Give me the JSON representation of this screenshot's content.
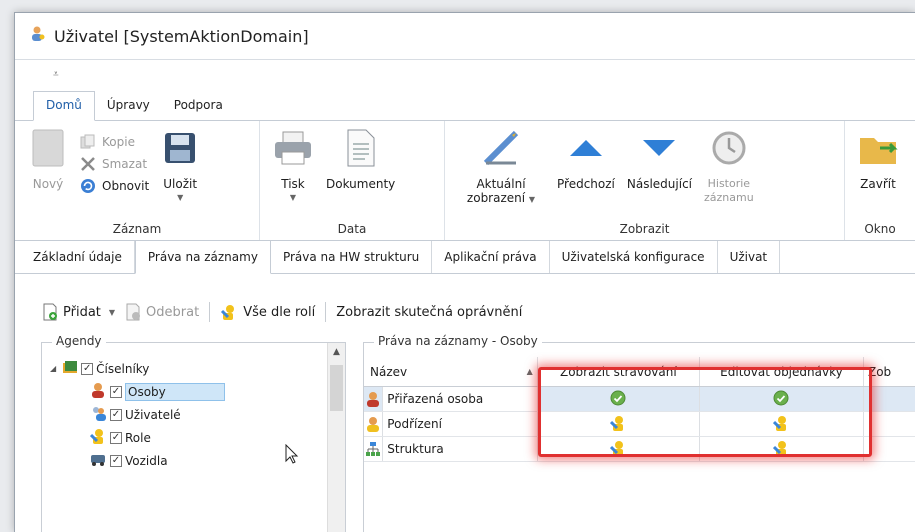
{
  "window": {
    "title": "Uživatel [SystemAktionDomain]"
  },
  "qat": {
    "symbol": "⩡"
  },
  "ribbon_tabs": [
    {
      "label": "Domů",
      "active": true
    },
    {
      "label": "Úpravy",
      "active": false
    },
    {
      "label": "Podpora",
      "active": false
    }
  ],
  "ribbon": {
    "zaznam": {
      "label": "Záznam",
      "novy": "Nový",
      "kopie": "Kopie",
      "smazat": "Smazat",
      "obnovit": "Obnovit",
      "ulozit": "Uložit"
    },
    "data": {
      "label": "Data",
      "tisk": "Tisk",
      "dokumenty": "Dokumenty"
    },
    "zobrazit": {
      "label": "Zobrazit",
      "aktualni_1": "Aktuální",
      "aktualni_2": "zobrazení",
      "predchozi": "Předchozí",
      "nasledujici": "Následující",
      "historie_1": "Historie",
      "historie_2": "záznamu"
    },
    "okno": {
      "label": "Okno",
      "zavrit": "Zavřít"
    }
  },
  "sub_tabs": [
    {
      "label": "Základní údaje",
      "active": false
    },
    {
      "label": "Práva na záznamy",
      "active": true
    },
    {
      "label": "Práva na HW strukturu",
      "active": false
    },
    {
      "label": "Aplikační práva",
      "active": false
    },
    {
      "label": "Uživatelská konfigurace",
      "active": false
    },
    {
      "label": "Uživat",
      "active": false
    }
  ],
  "toolbar": {
    "pridat": "Přidat",
    "odebrat": "Odebrat",
    "vse_dle_roli": "Vše dle rolí",
    "zobrazit_opravneni": "Zobrazit skutečná oprávnění"
  },
  "agendy": {
    "legend": "Agendy",
    "items": [
      {
        "label": "Číselníky",
        "checked": true,
        "level": 0,
        "icon": "folder-group-icon"
      },
      {
        "label": "Osoby",
        "checked": true,
        "level": 1,
        "icon": "person-icon",
        "selected": true
      },
      {
        "label": "Uživatelé",
        "checked": true,
        "level": 1,
        "icon": "users-icon"
      },
      {
        "label": "Role",
        "checked": true,
        "level": 1,
        "icon": "role-key-icon"
      },
      {
        "label": "Vozidla",
        "checked": true,
        "level": 1,
        "icon": "vehicle-icon"
      }
    ]
  },
  "prava": {
    "legend": "Práva na záznamy - Osoby",
    "columns": [
      "Název",
      "Zobrazit stravování",
      "Editovat objednávky",
      "Zob"
    ],
    "rows": [
      {
        "name": "Přiřazená osoba",
        "icon": "person-icon",
        "col1": "check-icon",
        "col2": "check-icon"
      },
      {
        "name": "Podřízení",
        "icon": "subordinate-icon",
        "col1": "role-key-icon",
        "col2": "role-key-icon"
      },
      {
        "name": "Struktura",
        "icon": "structure-icon",
        "col1": "role-key-icon",
        "col2": "role-key-icon"
      }
    ]
  }
}
